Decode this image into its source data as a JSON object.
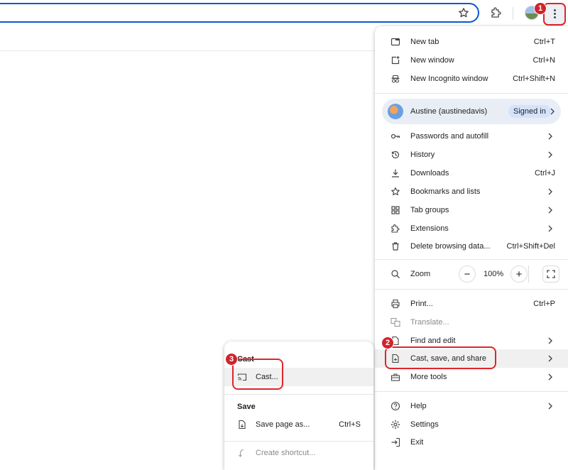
{
  "toolbar": {
    "icons": [
      "star-icon",
      "extensions-icon",
      "avatar",
      "more-vert-icon"
    ]
  },
  "badges": [
    "1",
    "2",
    "3"
  ],
  "menu": {
    "new_tab": {
      "label": "New tab",
      "shortcut": "Ctrl+T"
    },
    "new_window": {
      "label": "New window",
      "shortcut": "Ctrl+N"
    },
    "new_incognito": {
      "label": "New Incognito window",
      "shortcut": "Ctrl+Shift+N"
    },
    "profile": {
      "name": "Austine (austinedavis)",
      "status": "Signed in"
    },
    "passwords": {
      "label": "Passwords and autofill"
    },
    "history": {
      "label": "History"
    },
    "downloads": {
      "label": "Downloads",
      "shortcut": "Ctrl+J"
    },
    "bookmarks": {
      "label": "Bookmarks and lists"
    },
    "tab_groups": {
      "label": "Tab groups"
    },
    "extensions": {
      "label": "Extensions"
    },
    "delete_data": {
      "label": "Delete browsing data...",
      "shortcut": "Ctrl+Shift+Del"
    },
    "zoom": {
      "label": "Zoom",
      "minus": "−",
      "value": "100%",
      "plus": "+"
    },
    "print": {
      "label": "Print...",
      "shortcut": "Ctrl+P"
    },
    "translate": {
      "label": "Translate..."
    },
    "find_edit": {
      "label": "Find and edit"
    },
    "cast_save_share": {
      "label": "Cast, save, and share"
    },
    "more_tools": {
      "label": "More tools"
    },
    "help": {
      "label": "Help"
    },
    "settings": {
      "label": "Settings"
    },
    "exit": {
      "label": "Exit"
    }
  },
  "submenu": {
    "cast_heading": "Cast",
    "cast": {
      "label": "Cast..."
    },
    "save_heading": "Save",
    "save_page": {
      "label": "Save page as...",
      "shortcut": "Ctrl+S"
    },
    "create_shortcut": {
      "label": "Create shortcut..."
    }
  },
  "colors": {
    "accent": "#0b57d0",
    "highlight": "#e0242b",
    "badge": "#d1232a"
  }
}
